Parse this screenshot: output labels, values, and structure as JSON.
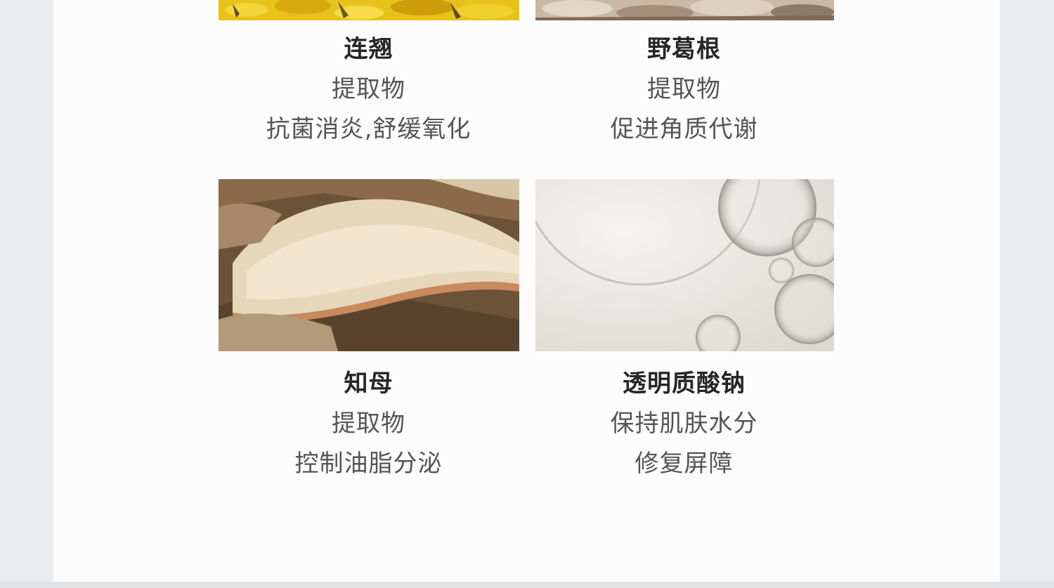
{
  "ingredients": [
    {
      "name": "连翘",
      "line1": "提取物",
      "line2": "抗菌消炎,舒缓氧化",
      "image_icon": "forsythia-flowers-photo"
    },
    {
      "name": "野葛根",
      "line1": "提取物",
      "line2": "促进角质代谢",
      "image_icon": "kudzu-root-photo"
    },
    {
      "name": "知母",
      "line1": "提取物",
      "line2": "控制油脂分泌",
      "image_icon": "anemarrhena-root-photo"
    },
    {
      "name": "透明质酸钠",
      "line1": "保持肌肤水分",
      "line2": "修复屏障",
      "image_icon": "hyaluronic-acid-bubbles-photo"
    }
  ],
  "colors": {
    "background": "#ebeced",
    "panel": "#fdfcfd",
    "heading": "#262626",
    "body_text": "#555555"
  }
}
